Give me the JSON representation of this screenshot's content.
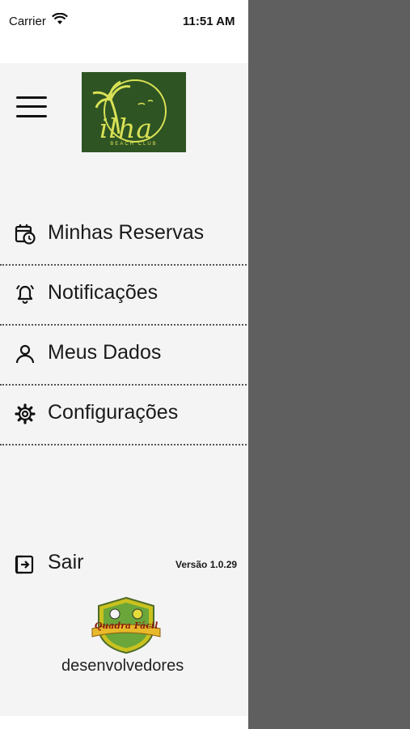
{
  "status": {
    "carrier": "Carrier",
    "time": "11:51 AM",
    "wifi_icon": "wifi-icon"
  },
  "header": {
    "menu_icon": "hamburger-menu-icon",
    "logo_text": "ilha",
    "logo_sub": "BEACH CLUB"
  },
  "menu": [
    {
      "label": "Minhas Reservas",
      "icon": "calendar-clock-icon"
    },
    {
      "label": "Notificações",
      "icon": "bell-icon"
    },
    {
      "label": "Meus Dados",
      "icon": "user-icon"
    },
    {
      "label": "Configurações",
      "icon": "gear-icon"
    }
  ],
  "footer": {
    "logout_label": "Sair",
    "version": "Versão 1.0.29",
    "badge_text": "Quadra Fácil",
    "developer_text": "desenvolvedores"
  },
  "colors": {
    "drawer_bg": "#f4f4f4",
    "overlay": "#5f5f5f",
    "logo_bg": "#2f5423",
    "logo_fg": "#d9e256"
  }
}
